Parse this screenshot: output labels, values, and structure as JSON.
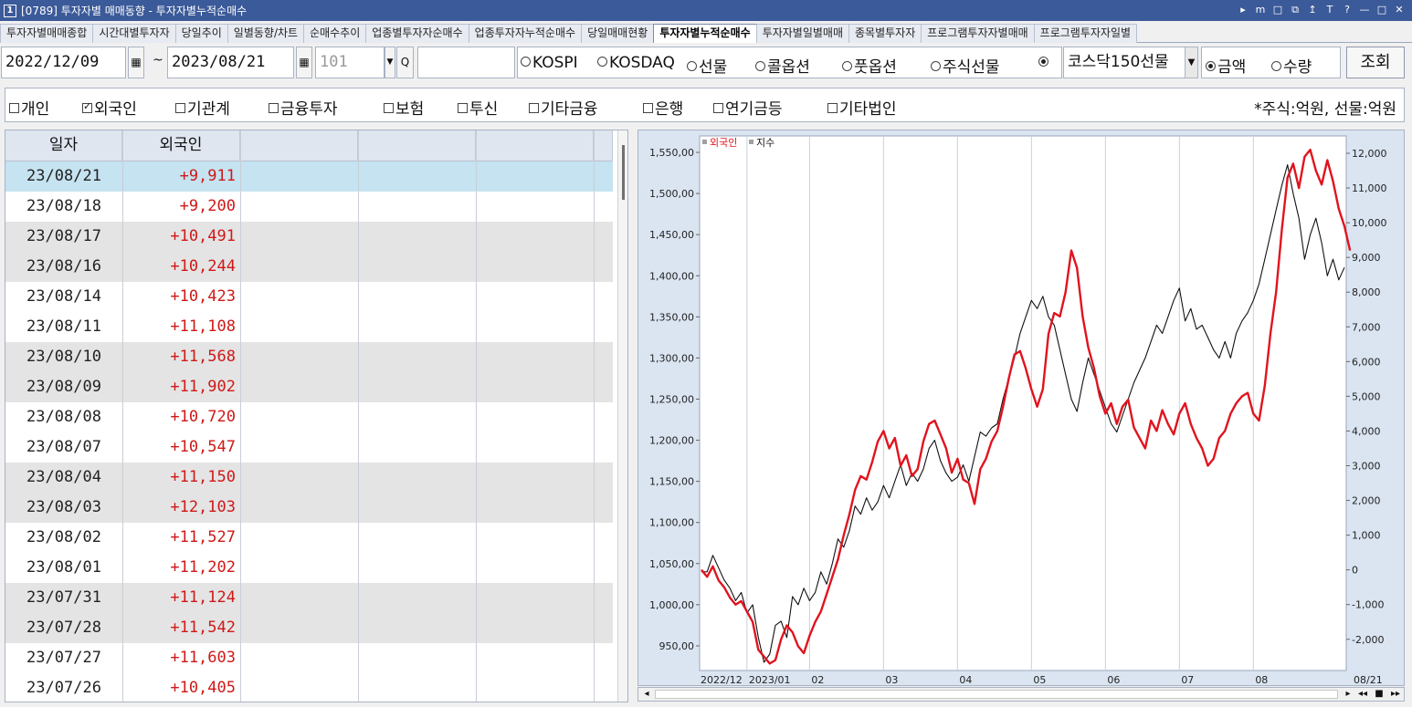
{
  "window": {
    "app_number": "1",
    "title": "[0789] 투자자별 매매동향 - 투자자별누적순매수",
    "buttons": [
      "▸",
      "m",
      "□",
      "⧉",
      "↥",
      "T",
      "?",
      "—",
      "□",
      "✕"
    ]
  },
  "tabs": [
    {
      "label": "투자자별매매종합",
      "active": false
    },
    {
      "label": "시간대별투자자",
      "active": false
    },
    {
      "label": "당일추이",
      "active": false
    },
    {
      "label": "일별동향/차트",
      "active": false
    },
    {
      "label": "순매수추이",
      "active": false
    },
    {
      "label": "업종별투자자순매수",
      "active": false
    },
    {
      "label": "업종투자자누적순매수",
      "active": false
    },
    {
      "label": "당일매매현황",
      "active": false
    },
    {
      "label": "투자자별누적순매수",
      "active": true
    },
    {
      "label": "투자자별일별매매",
      "active": false
    },
    {
      "label": "종목별투자자",
      "active": false
    },
    {
      "label": "프로그램투자자별매매",
      "active": false
    },
    {
      "label": "프로그램투자자일별",
      "active": false
    }
  ],
  "filters": {
    "start_date": "2022/12/09",
    "tilde": "~",
    "end_date": "2023/08/21",
    "code": "101",
    "market_options": [
      {
        "label": "KOSPI",
        "selected": false
      },
      {
        "label": "KOSDAQ",
        "selected": false
      },
      {
        "label": "선물",
        "selected": false
      },
      {
        "label": "콜옵션",
        "selected": false
      },
      {
        "label": "풋옵션",
        "selected": false
      },
      {
        "label": "주식선물",
        "selected": false
      },
      {
        "label": "",
        "selected": true
      }
    ],
    "product_select": "코스닥150선물",
    "unit_options": [
      {
        "label": "금액",
        "selected": true
      },
      {
        "label": "수량",
        "selected": false
      }
    ],
    "query_label": "조회"
  },
  "investors": [
    {
      "label": "개인",
      "checked": false
    },
    {
      "label": "외국인",
      "checked": true
    },
    {
      "label": "기관계",
      "checked": false
    },
    {
      "label": "금융투자",
      "checked": false
    },
    {
      "label": "보험",
      "checked": false
    },
    {
      "label": "투신",
      "checked": false
    },
    {
      "label": "기타금융",
      "checked": false
    },
    {
      "label": "은행",
      "checked": false
    },
    {
      "label": "연기금등",
      "checked": false
    },
    {
      "label": "기타법인",
      "checked": false
    }
  ],
  "unit_note": "*주식:억원, 선물:억원",
  "table": {
    "headers": [
      "일자",
      "외국인",
      "",
      "",
      "",
      ""
    ],
    "rows": [
      {
        "date": "23/08/21",
        "value": "+9,911"
      },
      {
        "date": "23/08/18",
        "value": "+9,200"
      },
      {
        "date": "23/08/17",
        "value": "+10,491"
      },
      {
        "date": "23/08/16",
        "value": "+10,244"
      },
      {
        "date": "23/08/14",
        "value": "+10,423"
      },
      {
        "date": "23/08/11",
        "value": "+11,108"
      },
      {
        "date": "23/08/10",
        "value": "+11,568"
      },
      {
        "date": "23/08/09",
        "value": "+11,902"
      },
      {
        "date": "23/08/08",
        "value": "+10,720"
      },
      {
        "date": "23/08/07",
        "value": "+10,547"
      },
      {
        "date": "23/08/04",
        "value": "+11,150"
      },
      {
        "date": "23/08/03",
        "value": "+12,103"
      },
      {
        "date": "23/08/02",
        "value": "+11,527"
      },
      {
        "date": "23/08/01",
        "value": "+11,202"
      },
      {
        "date": "23/07/31",
        "value": "+11,124"
      },
      {
        "date": "23/07/28",
        "value": "+11,542"
      },
      {
        "date": "23/07/27",
        "value": "+11,603"
      },
      {
        "date": "23/07/26",
        "value": "+10,405"
      }
    ]
  },
  "colors": {
    "foreign": "#e0141e",
    "index": "#111111",
    "selected_row": "#c5e3f0",
    "shade_row": "#e4e4e4",
    "axis_bg": "#dbe5f2"
  },
  "chart_data": {
    "type": "line",
    "legend": [
      "외국인",
      "지수"
    ],
    "x_tick_labels": [
      "2022/12",
      "2023/01",
      "02",
      "03",
      "04",
      "05",
      "06",
      "07",
      "08",
      "08/21"
    ],
    "y_left_ticks": [
      "950,00",
      "1,000,00",
      "1,050,00",
      "1,100,00",
      "1,150,00",
      "1,200,00",
      "1,250,00",
      "1,300,00",
      "1,350,00",
      "1,400,00",
      "1,450,00",
      "1,500,00",
      "1,550,00"
    ],
    "y_right_ticks": [
      "-2,000",
      "-1,000",
      "0",
      "1,000",
      "2,000",
      "3,000",
      "4,000",
      "5,000",
      "6,000",
      "7,000",
      "8,000",
      "9,000",
      "10,000",
      "11,000",
      "12,000"
    ],
    "ylim_left": [
      920,
      1570
    ],
    "ylim_right": [
      -2900,
      12500
    ],
    "grid": true,
    "series": [
      {
        "name": "지수",
        "axis": "left",
        "values": [
          1040,
          1040,
          1060,
          1045,
          1030,
          1020,
          1005,
          1015,
          990,
          1000,
          960,
          930,
          940,
          975,
          980,
          960,
          1010,
          1000,
          1020,
          1005,
          1015,
          1040,
          1025,
          1050,
          1080,
          1070,
          1090,
          1120,
          1110,
          1130,
          1115,
          1125,
          1145,
          1130,
          1150,
          1170,
          1145,
          1160,
          1150,
          1165,
          1190,
          1200,
          1175,
          1160,
          1150,
          1155,
          1170,
          1150,
          1180,
          1210,
          1205,
          1215,
          1220,
          1250,
          1275,
          1300,
          1330,
          1350,
          1370,
          1360,
          1375,
          1350,
          1340,
          1310,
          1280,
          1250,
          1235,
          1270,
          1300,
          1280,
          1260,
          1240,
          1220,
          1210,
          1230,
          1250,
          1270,
          1285,
          1300,
          1320,
          1340,
          1330,
          1350,
          1370,
          1385,
          1345,
          1360,
          1335,
          1340,
          1325,
          1310,
          1300,
          1320,
          1300,
          1330,
          1345,
          1355,
          1370,
          1390,
          1420,
          1450,
          1480,
          1510,
          1535,
          1500,
          1470,
          1420,
          1450,
          1470,
          1440,
          1400,
          1420,
          1395,
          1410
        ]
      },
      {
        "name": "외국인",
        "axis": "right",
        "values": [
          0,
          -200,
          100,
          -300,
          -500,
          -800,
          -1000,
          -900,
          -1200,
          -1500,
          -2300,
          -2500,
          -2700,
          -2600,
          -2000,
          -1600,
          -1800,
          -2200,
          -2400,
          -1900,
          -1500,
          -1200,
          -700,
          -200,
          300,
          1000,
          1600,
          2300,
          2700,
          2600,
          3100,
          3700,
          4000,
          3500,
          3800,
          3000,
          3300,
          2700,
          2900,
          3700,
          4200,
          4300,
          3900,
          3500,
          2800,
          3200,
          2600,
          2500,
          1900,
          2900,
          3200,
          3700,
          4000,
          4700,
          5500,
          6200,
          6300,
          5800,
          5200,
          4700,
          5200,
          6800,
          7400,
          7300,
          8000,
          9200,
          8700,
          7300,
          6400,
          5800,
          5000,
          4500,
          4800,
          4200,
          4700,
          4900,
          4100,
          3800,
          3500,
          4300,
          4000,
          4600,
          4200,
          3900,
          4500,
          4800,
          4200,
          3800,
          3500,
          3000,
          3200,
          3800,
          4000,
          4500,
          4800,
          5000,
          5100,
          4500,
          4300,
          5300,
          6800,
          8000,
          9800,
          11300,
          11700,
          11000,
          11900,
          12100,
          11500,
          11100,
          11800,
          11200,
          10400,
          9900,
          9200
        ]
      }
    ]
  }
}
